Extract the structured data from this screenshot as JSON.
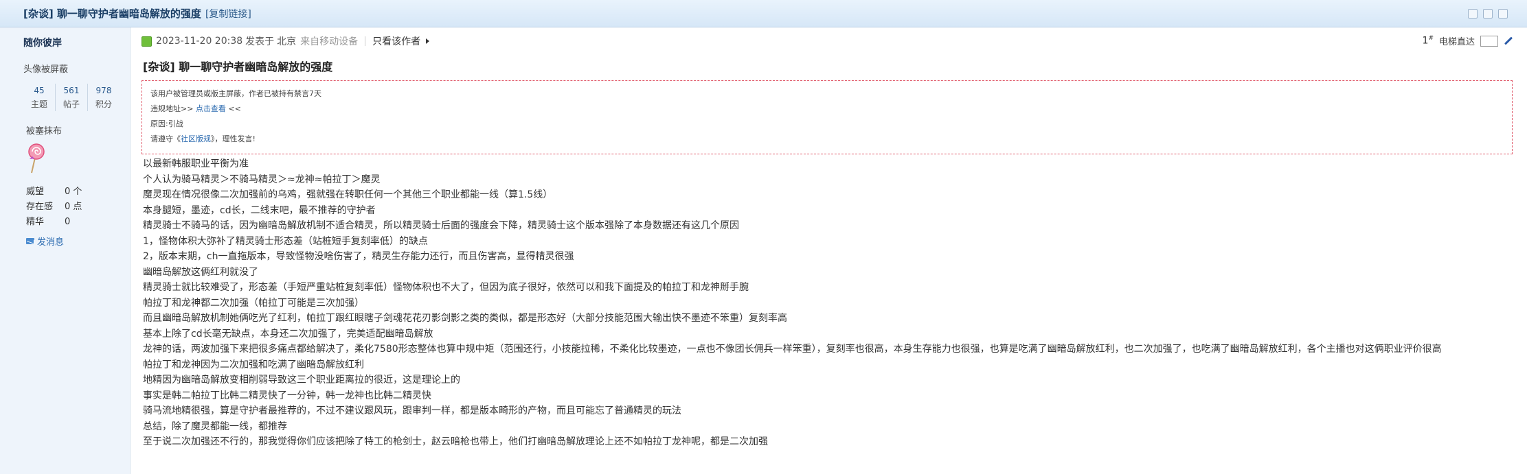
{
  "header": {
    "title": "[杂谈] 聊一聊守护者幽暗岛解放的强度",
    "copy_link": "[复制链接]"
  },
  "sidebar": {
    "username": "随你彼岸",
    "avatar_status": "头像被屏蔽",
    "stats": [
      {
        "value": "45",
        "label": "主题"
      },
      {
        "value": "561",
        "label": "帖子"
      },
      {
        "value": "978",
        "label": "积分"
      }
    ],
    "ban_status": "被塞抹布",
    "attributes": [
      {
        "label": "威望",
        "value": "0 个"
      },
      {
        "label": "存在感",
        "value": "0 点"
      },
      {
        "label": "精华",
        "value": "0"
      }
    ],
    "send_message": "发消息"
  },
  "post": {
    "date": "2023-11-20 20:38",
    "posted_from": "发表于",
    "location": "北京",
    "device": "来自移动设备",
    "author_only": "只看该作者",
    "floor": "1",
    "floor_suffix": "#",
    "elevator_label": "电梯直达",
    "title": "[杂谈] 聊一聊守护者幽暗岛解放的强度",
    "notice": {
      "line1": "该用户被管理员或版主屏蔽，作者已被持有禁言7天",
      "line2_prefix": "违规地址>> ",
      "line2_link": "点击查看",
      "line2_suffix": " <<",
      "line3": "原因:引战",
      "line4_prefix": "请遵守《",
      "line4_link": "社区版规",
      "line4_suffix": "》，理性发言!"
    },
    "body": [
      "以最新韩服职业平衡为准",
      "个人认为骑马精灵＞不骑马精灵＞≈龙神≈帕拉丁＞魔灵",
      "魔灵现在情况很像二次加强前的乌鸡，强就强在转职任何一个其他三个职业都能一线（算1.5线）",
      "本身腿短，墨迹，cd长，二线末吧，最不推荐的守护者",
      "精灵骑士不骑马的话，因为幽暗岛解放机制不适合精灵，所以精灵骑士后面的强度会下降，精灵骑士这个版本强除了本身数据还有这几个原因",
      "1，怪物体积大弥补了精灵骑士形态差（站桩短手复刻率低）的缺点",
      "2，版本末期，ch一直拖版本，导致怪物没啥伤害了，精灵生存能力还行，而且伤害高，显得精灵很强",
      "幽暗岛解放这俩红利就没了",
      "精灵骑士就比较难受了，形态差（手短严重站桩复刻率低）怪物体积也不大了，但因为底子很好，依然可以和我下面提及的帕拉丁和龙神掰手腕",
      "帕拉丁和龙神都二次加强（帕拉丁可能是三次加强）",
      "而且幽暗岛解放机制她俩吃光了红利，帕拉丁跟红眼瞎子剑魂花花刃影剑影之类的类似，都是形态好（大部分技能范围大输出快不墨迹不笨重）复刻率高",
      "基本上除了cd长毫无缺点，本身还二次加强了，完美适配幽暗岛解放",
      "龙神的话，两波加强下来把很多痛点都给解决了，柔化7580形态整体也算中规中矩（范围还行，小技能拉稀，不柔化比较墨迹，一点也不像团长佣兵一样笨重），复刻率也很高，本身生存能力也很强，也算是吃满了幽暗岛解放红利，也二次加强了，也吃满了幽暗岛解放红利，各个主播也对这俩职业评价很高",
      "帕拉丁和龙神因为二次加强和吃满了幽暗岛解放红利",
      "地精因为幽暗岛解放变相削弱导致这三个职业距离拉的很近，这是理论上的",
      "事实是韩二帕拉丁比韩二精灵快了一分钟，韩一龙神也比韩二精灵快",
      "骑马流地精很强，算是守护者最推荐的，不过不建议跟风玩，跟审判一样，都是版本畸形的产物，而且可能忘了普通精灵的玩法",
      "总结，除了魔灵都能一线，都推荐",
      "至于说二次加强还不行的，那我觉得你们应该把除了特工的枪剑士，赵云暗枪也带上，他们打幽暗岛解放理论上还不如帕拉丁龙神呢，都是二次加强"
    ]
  }
}
